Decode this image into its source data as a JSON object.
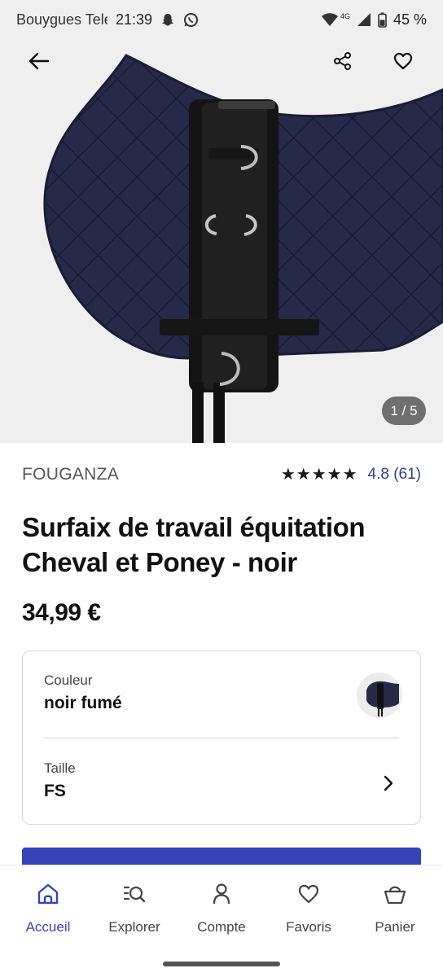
{
  "status_bar": {
    "carrier": "Bouygues Tele",
    "time": "21:39",
    "network": "4G",
    "battery": "45 %"
  },
  "hero": {
    "pager": "1 / 5"
  },
  "product": {
    "brand": "FOUGANZA",
    "stars": "★★★★★",
    "rating": "4.8 (61)",
    "title": "Surfaix de travail équitation Cheval et Poney - noir",
    "price": "34,99 €"
  },
  "options": {
    "color_label": "Couleur",
    "color_value": "noir fumé",
    "size_label": "Taille",
    "size_value": "FS"
  },
  "nav": {
    "items": [
      {
        "label": "Accueil",
        "icon": "home-icon",
        "active": true
      },
      {
        "label": "Explorer",
        "icon": "explore-search-icon",
        "active": false
      },
      {
        "label": "Compte",
        "icon": "account-icon",
        "active": false
      },
      {
        "label": "Favoris",
        "icon": "heart-icon",
        "active": false
      },
      {
        "label": "Panier",
        "icon": "basket-icon",
        "active": false
      }
    ]
  },
  "colors": {
    "accent": "#3643ba",
    "rating_text": "#2f3d9c",
    "pad_navy": "#252848"
  }
}
